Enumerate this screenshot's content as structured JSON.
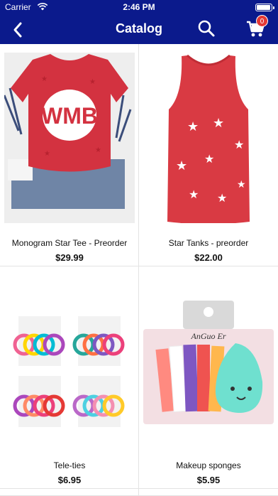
{
  "status_bar": {
    "carrier": "Carrier",
    "time": "2:46 PM",
    "battery_level": 0.95
  },
  "nav": {
    "title": "Catalog",
    "cart_count": "0",
    "accent": "#0b1a8c",
    "badge_color": "#e53935"
  },
  "products": [
    {
      "name": "Monogram Star Tee - Preorder",
      "price": "$29.99",
      "photo_text": "WMB",
      "photo_icon": "red-star-tshirt-image"
    },
    {
      "name": "Star Tanks - preorder",
      "price": "$22.00",
      "photo_icon": "red-star-tank-top-image"
    },
    {
      "name": "Tele-ties",
      "price": "$6.95",
      "photo_icon": "spiral-hair-ties-image"
    },
    {
      "name": "Makeup sponges",
      "price": "$5.95",
      "photo_text": "AnGuo Er",
      "photo_icon": "makeup-sponge-pack-image"
    }
  ]
}
